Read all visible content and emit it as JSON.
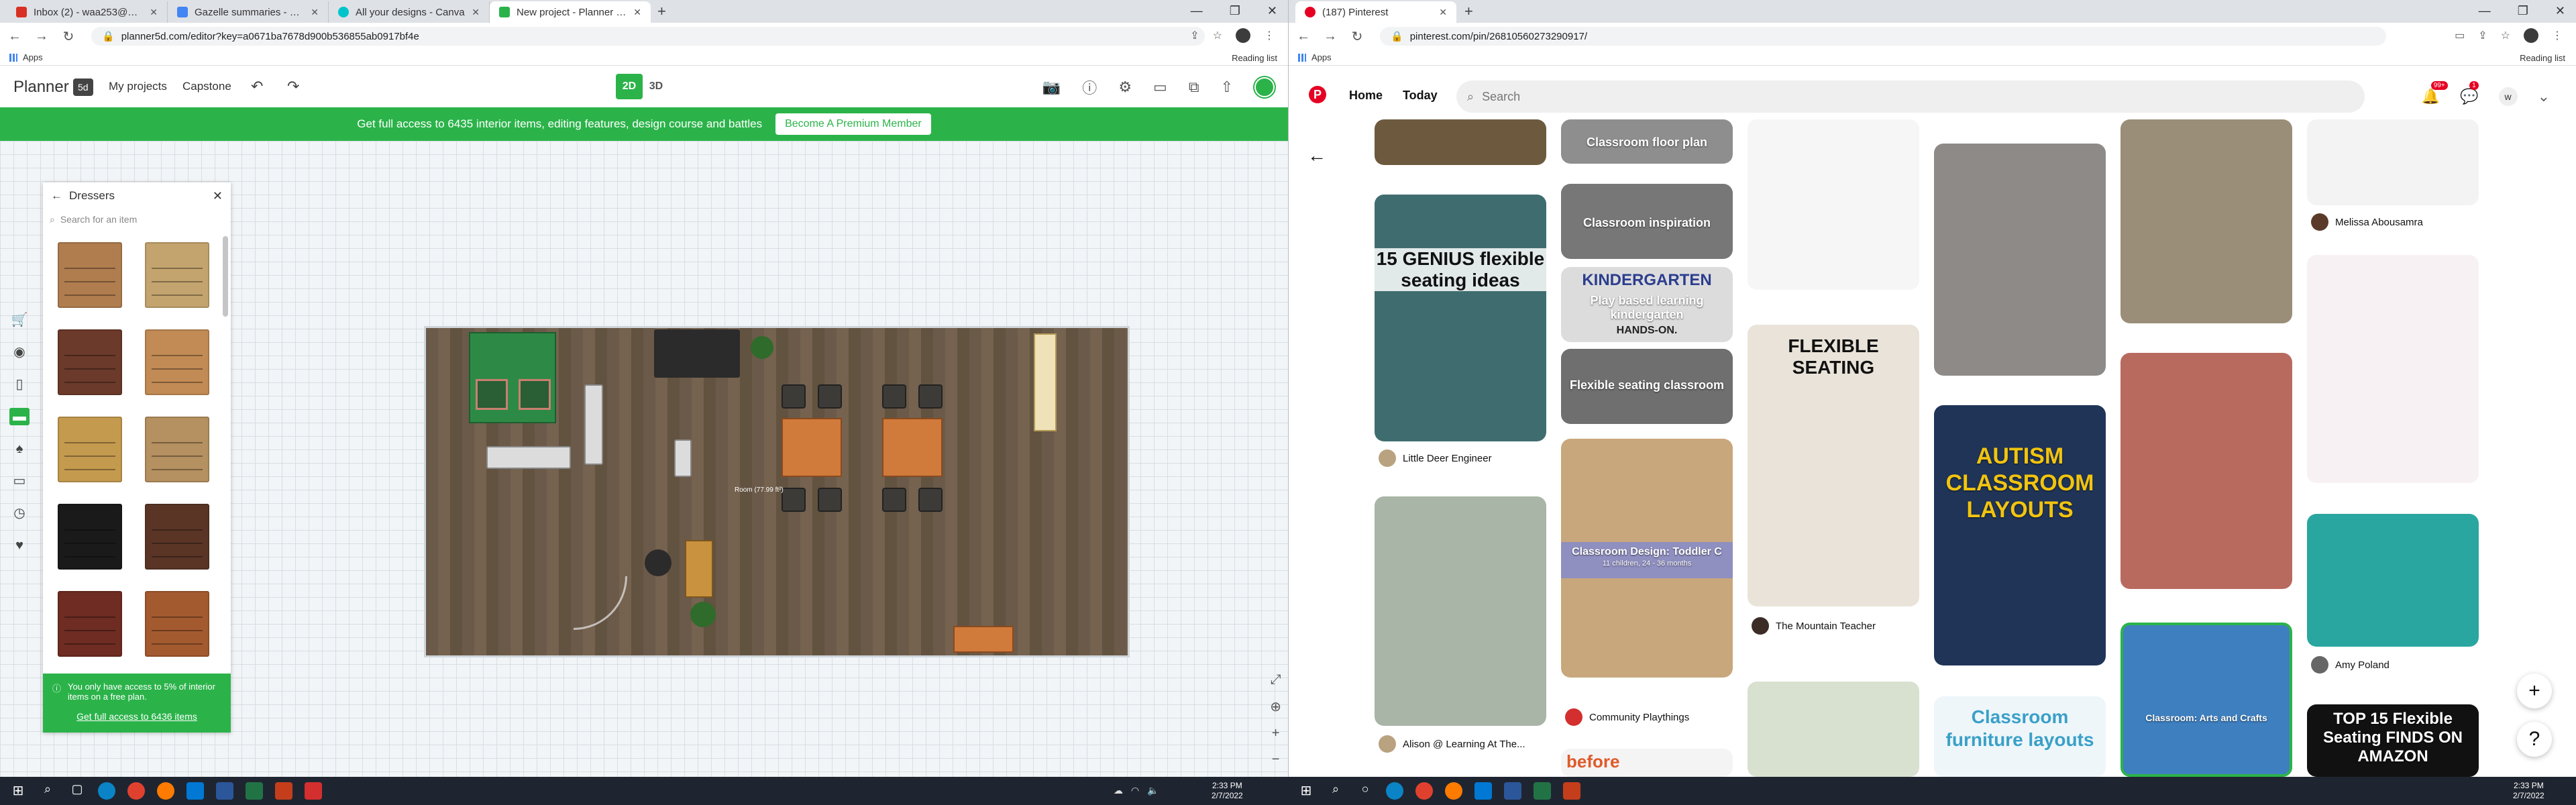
{
  "left_window": {
    "tabs": [
      {
        "label": "Inbox (2) - waa253@nyu.edu - N",
        "color": "#d93025"
      },
      {
        "label": "Gazelle summaries - Google Dri...",
        "color": "#4285f4"
      },
      {
        "label": "All your designs - Canva",
        "color": "#00c4cc"
      },
      {
        "label": "New project - Planner 5D",
        "color": "#2bb34a"
      }
    ],
    "url": "planner5d.com/editor?key=a0671ba7678d900b536855ab0917bf4e",
    "bookmarks": {
      "apps": "Apps",
      "reading_list": "Reading list"
    },
    "planner": {
      "logo": "Planner",
      "my_projects": "My projects",
      "project_name": "Capstone",
      "view_2d": "2D",
      "view_3d": "3D",
      "promo_text": "Get full access to 6435 interior items, editing features, design course and battles",
      "promo_button": "Become A Premium Member",
      "catalog": {
        "title": "Dressers",
        "search_placeholder": "Search for an item",
        "items": [
          "#b07d4f",
          "#c4a46e",
          "#6b3a2a",
          "#c28a54",
          "#c49a4f",
          "#b59060",
          "#1a1a1a",
          "#5a3526",
          "#6e2c22",
          "#a45a2f"
        ],
        "notice": "You only have access to 5% of interior items on a free plan.",
        "notice_link": "Get full access to 6436 items"
      },
      "room_label": "Room (77.99 ft²)"
    }
  },
  "right_window": {
    "tab": {
      "label": "(187) Pinterest",
      "color": "#e60023"
    },
    "url": "pinterest.com/pin/26810560273290917/",
    "bookmarks": {
      "apps": "Apps",
      "reading_list": "Reading list"
    },
    "pinterest": {
      "nav_home": "Home",
      "nav_today": "Today",
      "search_placeholder": "Search",
      "notif_badge": "99+",
      "msg_badge": "1",
      "avatar_letter": "w",
      "pins": [
        {
          "title": "Classroom floor plan"
        },
        {
          "title": "Classroom inspiration"
        },
        {
          "title": "KINDERGARTEN"
        },
        {
          "title": "Play based learning kindergarten"
        },
        {
          "title": "HANDS-ON."
        },
        {
          "title": "Flexible seating classroom"
        },
        {
          "title": "15 GENIUS flexible seating ideas"
        },
        {
          "title": "Classroom Design: Toddler C"
        },
        {
          "title": "11 children, 24 - 36 months"
        },
        {
          "title": "FLEXIBLE SEATING"
        },
        {
          "title": "AUTISM CLASSROOM LAYOUTS"
        },
        {
          "title": "Classroom furniture layouts"
        },
        {
          "title": "TOP 15 Flexible Seating FINDS ON AMAZON"
        },
        {
          "title": "before"
        },
        {
          "title": "Classroom: Arts and Crafts"
        }
      ],
      "authors": {
        "a1": "Little Deer Engineer",
        "a2": "Alison @ Learning At The...",
        "a3": "Community Playthings",
        "a4": "The Mountain Teacher",
        "a5": "Melissa Abousamra",
        "a6": "Amy Poland"
      }
    }
  },
  "taskbar": {
    "left_time": "2:33 PM",
    "left_date": "2/7/2022",
    "right_time": "2:33 PM",
    "right_date": "2/7/2022"
  }
}
